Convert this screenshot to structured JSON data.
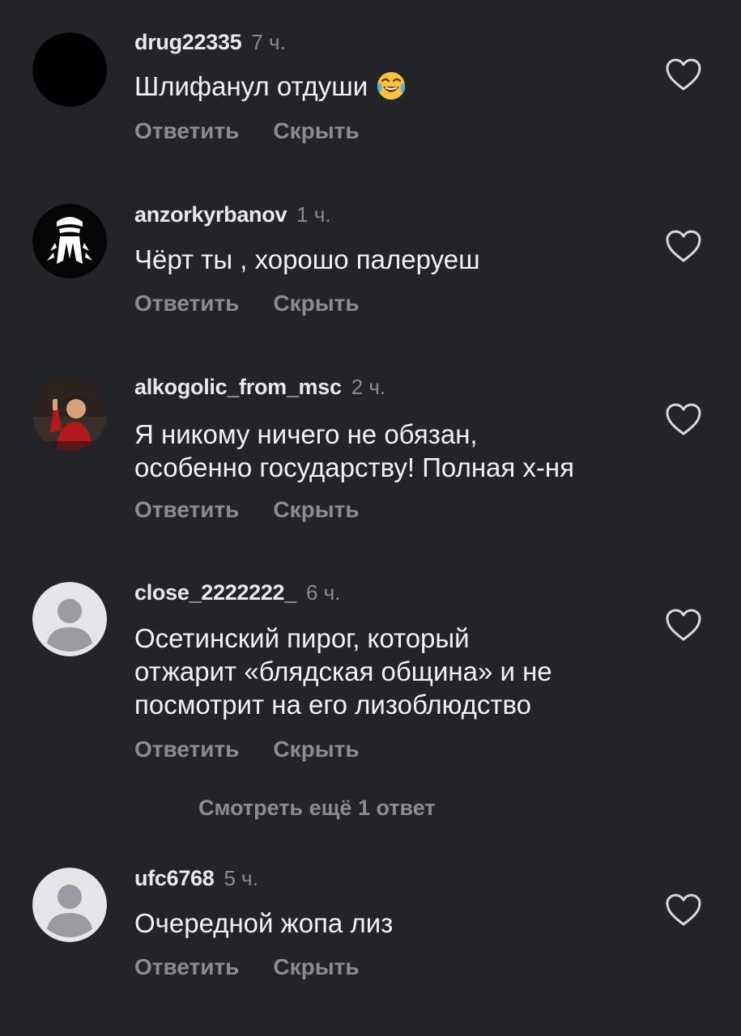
{
  "comments": [
    {
      "username": "drug22335",
      "time": "7 ч.",
      "text": "Шлифанул отдуши",
      "emoji": "face-with-tears-of-joy-icon",
      "reply_label": "Ответить",
      "hide_label": "Скрыть"
    },
    {
      "username": "anzorkyrbanov",
      "time": "1 ч.",
      "text": "Чёрт ты , хорошо палеруеш",
      "reply_label": "Ответить",
      "hide_label": "Скрыть"
    },
    {
      "username": "alkogolic_from_msc",
      "time": "2 ч.",
      "text_lines": [
        "Я никому ничего не обязан,",
        "особенно государству! Полная х-ня"
      ],
      "reply_label": "Ответить",
      "hide_label": "Скрыть"
    },
    {
      "username": "close_2222222_",
      "time": "6 ч.",
      "text_lines": [
        "Осетинский пирог, который",
        "отжарит «блядская община» и не",
        "посмотрит на его лизоблюдство"
      ],
      "reply_label": "Ответить",
      "hide_label": "Скрыть"
    },
    {
      "username": "ufc6768",
      "time": "5 ч.",
      "text": "Очередной жопа лиз",
      "reply_label": "Ответить",
      "hide_label": "Скрыть"
    }
  ],
  "more_replies_label": "Смотреть ещё 1 ответ",
  "colors": {
    "background": "#232428",
    "primary_text": "#f2f2f4",
    "secondary_text": "#8b8c91",
    "default_avatar_bg": "#e6e6e8",
    "default_avatar_fg": "#9a9ba0"
  }
}
